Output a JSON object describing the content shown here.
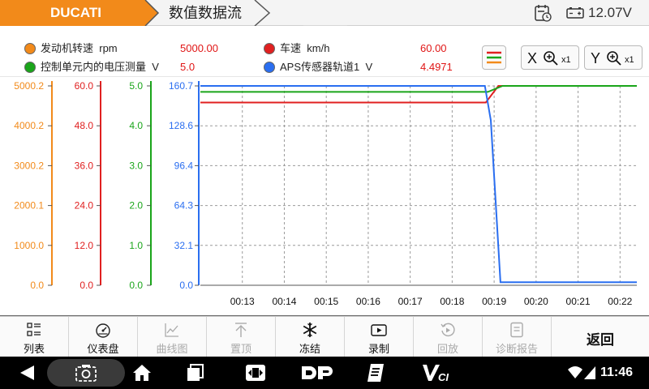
{
  "titlebar": {
    "brand": "DUCATI",
    "title": "数值数据流",
    "voltage": "12.07V"
  },
  "legend": {
    "items": [
      {
        "label": "发动机转速",
        "unit": "rpm",
        "value": "5000.00",
        "color": "#f28a1a"
      },
      {
        "label": "车速",
        "unit": "km/h",
        "value": "60.00",
        "color": "#e02020"
      },
      {
        "label": "控制单元内的电压测量",
        "unit": "V",
        "value": "5.0",
        "color": "#1aa51a"
      },
      {
        "label": "APS传感器轨道1",
        "unit": "V",
        "value": "4.4971",
        "color": "#2a6ef0"
      }
    ],
    "x_zoom": {
      "label": "X",
      "multiplier": "x1"
    },
    "y_zoom": {
      "label": "Y",
      "multiplier": "x1"
    }
  },
  "chart_data": {
    "type": "line",
    "x_ticks": [
      "00:13",
      "00:14",
      "00:15",
      "00:16",
      "00:17",
      "00:18",
      "00:19",
      "00:20",
      "00:21",
      "00:22"
    ],
    "y_axes": [
      {
        "name": "发动机转速",
        "color": "#f28a1a",
        "ticks": [
          "5000.2",
          "4000.2",
          "3000.2",
          "2000.1",
          "1000.0",
          "0.0"
        ],
        "ylim": [
          0,
          5000.2
        ]
      },
      {
        "name": "车速",
        "color": "#e02020",
        "ticks": [
          "60.0",
          "48.0",
          "36.0",
          "24.0",
          "12.0",
          "0.0"
        ],
        "ylim": [
          0,
          60.0
        ]
      },
      {
        "name": "控制单元内的电压测量",
        "color": "#1aa51a",
        "ticks": [
          "5.0",
          "4.0",
          "3.0",
          "2.0",
          "1.0",
          "0.0"
        ],
        "ylim": [
          0,
          5.0
        ]
      },
      {
        "name": "APS传感器轨道1",
        "color": "#2a6ef0",
        "ticks": [
          "160.7",
          "128.6",
          "96.4",
          "64.3",
          "32.1",
          "0.0"
        ],
        "ylim": [
          0,
          160.7
        ]
      }
    ],
    "series": [
      {
        "name": "车速",
        "color": "#e02020",
        "axis": 1,
        "points": [
          [
            12.0,
            55.0
          ],
          [
            18.8,
            55.0
          ],
          [
            19.1,
            60.0
          ],
          [
            22.4,
            60.0
          ]
        ]
      },
      {
        "name": "控制单元内的电压测量",
        "color": "#1aa51a",
        "axis": 2,
        "points": [
          [
            12.0,
            4.85
          ],
          [
            18.85,
            4.85
          ],
          [
            19.2,
            5.0
          ],
          [
            22.4,
            5.0
          ]
        ]
      },
      {
        "name": "APS传感器轨道1",
        "color": "#2a6ef0",
        "axis": 3,
        "points": [
          [
            12.0,
            160.7
          ],
          [
            18.78,
            160.7
          ],
          [
            18.92,
            133.0
          ],
          [
            19.15,
            2.5
          ],
          [
            22.4,
            2.5
          ]
        ]
      }
    ],
    "xlim": [
      12.0,
      22.4
    ],
    "grid": true
  },
  "toolbar": {
    "items": [
      {
        "name": "list",
        "label": "列表",
        "enabled": true
      },
      {
        "name": "dashboard",
        "label": "仪表盘",
        "enabled": true
      },
      {
        "name": "curve",
        "label": "曲线图",
        "enabled": false
      },
      {
        "name": "pin-top",
        "label": "置顶",
        "enabled": false
      },
      {
        "name": "freeze",
        "label": "冻结",
        "enabled": true
      },
      {
        "name": "record",
        "label": "录制",
        "enabled": true
      },
      {
        "name": "playback",
        "label": "回放",
        "enabled": false
      },
      {
        "name": "diagnostic-report",
        "label": "诊断报告",
        "enabled": false
      }
    ],
    "back_label": "返回"
  },
  "navbar": {
    "clock": "11:46"
  }
}
